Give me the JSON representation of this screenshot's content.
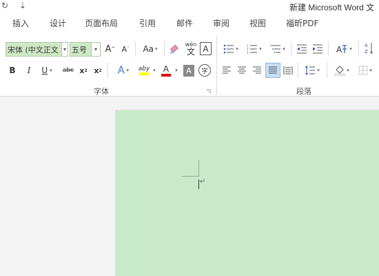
{
  "titlebar": {
    "undo_icon": "redo-arrow-icon",
    "customize_icon": "customize-dropdown-icon",
    "title": "新建 Microsoft Word 文"
  },
  "tabs": [
    "插入",
    "设计",
    "页面布局",
    "引用",
    "邮件",
    "审阅",
    "视图",
    "福昕PDF"
  ],
  "font_group": {
    "font_name": "宋体 (中文正文",
    "font_size": "五号",
    "grow_font": "A",
    "shrink_font": "A",
    "change_case": "Aa",
    "phonetic_guide": "wén",
    "phonetic_guide_char": "文",
    "char_border": "A",
    "bold": "B",
    "italic": "I",
    "underline": "U",
    "strikethrough": "abc",
    "subscript": "x",
    "superscript": "x",
    "text_effects": "A",
    "highlight": "aby",
    "font_color": "A",
    "char_shading": "A",
    "enclose_char": "字",
    "label": "字体",
    "colors": {
      "highlight": "#ffff00",
      "font_color": "#e00000",
      "text_effects": "#4a7fd4"
    }
  },
  "paragraph_group": {
    "label": "段落"
  },
  "document": {
    "page_color": "#c8eac8"
  }
}
